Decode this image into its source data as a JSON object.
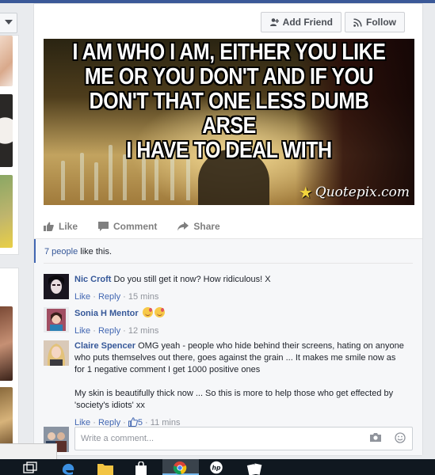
{
  "header": {
    "add_friend_label": "Add Friend",
    "follow_label": "Follow"
  },
  "post": {
    "image_quote_lines": [
      "I AM WHO I AM, EITHER YOU LIKE",
      "ME OR YOU DON'T AND IF YOU",
      "DON'T THAT ONE LESS DUMB ARSE",
      "I HAVE TO DEAL WITH"
    ],
    "watermark": "Quotepix.com",
    "actions": {
      "like": "Like",
      "comment": "Comment",
      "share": "Share"
    }
  },
  "likes": {
    "count_link": "7 people",
    "suffix": " like this."
  },
  "comments": [
    {
      "author": "Nic Croft",
      "text": "Do you still get it now? How ridiculous! X",
      "like": "Like",
      "reply": "Reply",
      "time": "15 mins"
    },
    {
      "author": "Sonia H Mentor",
      "text": "",
      "like": "Like",
      "reply": "Reply",
      "time": "12 mins"
    },
    {
      "author": "Claire Spencer",
      "text": "OMG yeah - people who hide behind their screens, hating on anyone who puts themselves out there, goes against the grain ... It makes me smile now as for 1 negative comment I get 1000 positive ones",
      "text2": "My skin is beautifully thick now ... So this is more to help those who get effected by 'society's idiots' xx",
      "like": "Like",
      "reply": "Reply",
      "reactions": "5",
      "time": "11 mins"
    }
  ],
  "composer": {
    "placeholder": "Write a comment..."
  },
  "colors": {
    "link": "#365899",
    "brand": "#3b5998",
    "meta": "#90949c"
  }
}
